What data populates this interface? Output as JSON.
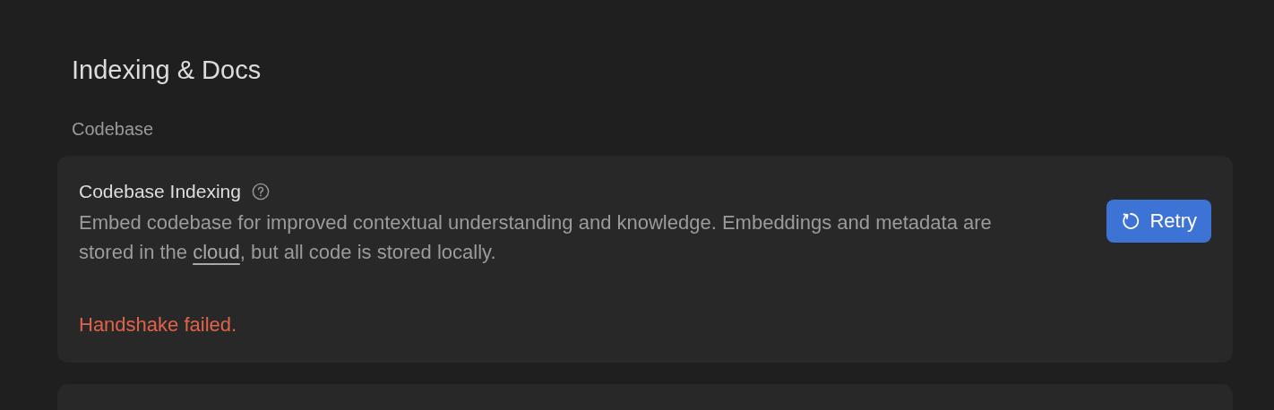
{
  "page": {
    "title": "Indexing & Docs"
  },
  "section": {
    "label": "Codebase"
  },
  "card": {
    "title": "Codebase Indexing",
    "description": {
      "before": "Embed codebase for improved contextual understanding and knowledge. Embeddings and metadata are stored in the ",
      "link": "cloud",
      "after": ", but all code is stored locally."
    },
    "button": "Retry",
    "error": "Handshake failed."
  }
}
